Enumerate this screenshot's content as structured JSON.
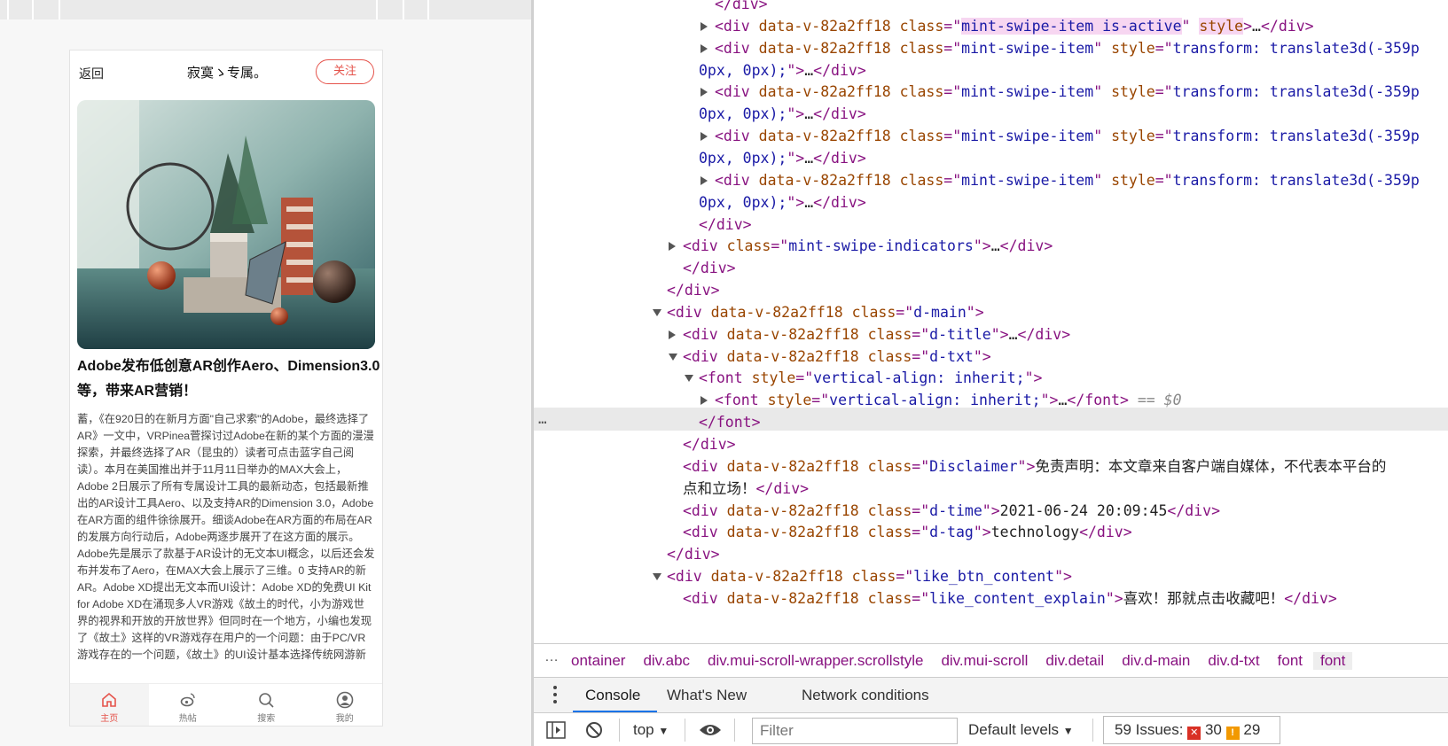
{
  "phone": {
    "back_label": "返回",
    "author_name": "寂寞ゝ专属。",
    "follow_label": "关注",
    "hero_image_icon": "still-life-render-image",
    "article_title": "Adobe发布低创意AR创作Aero、Dimension3.0等，带来AR营销！",
    "article_body": "蓄，《在920日的在新月方面\"自己求索\"的Adobe，最终选择了AR》一文中，VRPinea菅探讨过Adobe在新的某个方面的漫漫探索，并最终选择了AR（昆虫的）读者可点击蓝字自己阅读）。本月在美国推出并于11月11日举办的MAX大会上，Adobe 2日展示了所有专属设计工具的最新动态，包括最新推出的AR设计工具Aero、以及支持AR的Dimension 3.0，Adobe在AR方面的组件徐徐展开。细谈Adobe在AR方面的布局在AR的发展方向行动后，Adobe两逐步展开了在这方面的展示。Adobe先是展示了款基于AR设计的无文本UI概念，以后还会发布并发布了Aero，在MAX大会上展示了三维。0 支持AR的新AR。Adobe XD提出无文本而UI设计：Adobe XD的免费UI Kit for Adobe XD在涌现多人VR游戏《故土的时代，小为游戏世界的视界和开放的开放世界》但同时在一个地方，小编也发现了《故土》这样的VR游戏存在用户的一个问题：由于PC/VR游戏存在的一个问题，《故土》的UI设计基本选择传统网游新",
    "tabs": [
      {
        "label": "主页",
        "icon": "home-icon"
      },
      {
        "label": "热帖",
        "icon": "weibo-icon"
      },
      {
        "label": "搜索",
        "icon": "search-icon"
      },
      {
        "label": "我的",
        "icon": "user-icon"
      }
    ]
  },
  "dom": {
    "lines": [
      {
        "indent": 1,
        "tri": "",
        "parts": [
          [
            "t",
            "</div>"
          ]
        ]
      },
      {
        "indent": 1,
        "tri": "r",
        "parts": [
          [
            "t",
            "<div "
          ],
          [
            "a",
            "data-v-82a2ff18"
          ],
          [
            "t",
            " "
          ],
          [
            "a",
            "class"
          ],
          [
            "t",
            "=\""
          ],
          [
            "vh",
            "mint-swipe-item is-active"
          ],
          [
            "t",
            "\" "
          ],
          [
            "ah",
            "style"
          ],
          [
            "t",
            ">"
          ],
          [
            "p",
            "…"
          ],
          [
            "t",
            "</div>"
          ]
        ]
      },
      {
        "indent": 1,
        "tri": "r",
        "parts": [
          [
            "t",
            "<div "
          ],
          [
            "a",
            "data-v-82a2ff18"
          ],
          [
            "t",
            " "
          ],
          [
            "a",
            "class"
          ],
          [
            "t",
            "=\""
          ],
          [
            "v",
            "mint-swipe-item"
          ],
          [
            "t",
            "\" "
          ],
          [
            "a",
            "style"
          ],
          [
            "t",
            "=\""
          ],
          [
            "v",
            "transform: translate3d(-359p"
          ]
        ]
      },
      {
        "indent": 0,
        "tri": "",
        "parts": [
          [
            "v",
            "0px, 0px);"
          ],
          [
            "t",
            "\">"
          ],
          [
            "p",
            "…"
          ],
          [
            "t",
            "</div>"
          ]
        ]
      },
      {
        "indent": 1,
        "tri": "r",
        "parts": [
          [
            "t",
            "<div "
          ],
          [
            "a",
            "data-v-82a2ff18"
          ],
          [
            "t",
            " "
          ],
          [
            "a",
            "class"
          ],
          [
            "t",
            "=\""
          ],
          [
            "v",
            "mint-swipe-item"
          ],
          [
            "t",
            "\" "
          ],
          [
            "a",
            "style"
          ],
          [
            "t",
            "=\""
          ],
          [
            "v",
            "transform: translate3d(-359p"
          ]
        ]
      },
      {
        "indent": 0,
        "tri": "",
        "parts": [
          [
            "v",
            "0px, 0px);"
          ],
          [
            "t",
            "\">"
          ],
          [
            "p",
            "…"
          ],
          [
            "t",
            "</div>"
          ]
        ]
      },
      {
        "indent": 1,
        "tri": "r",
        "parts": [
          [
            "t",
            "<div "
          ],
          [
            "a",
            "data-v-82a2ff18"
          ],
          [
            "t",
            " "
          ],
          [
            "a",
            "class"
          ],
          [
            "t",
            "=\""
          ],
          [
            "v",
            "mint-swipe-item"
          ],
          [
            "t",
            "\" "
          ],
          [
            "a",
            "style"
          ],
          [
            "t",
            "=\""
          ],
          [
            "v",
            "transform: translate3d(-359p"
          ]
        ]
      },
      {
        "indent": 0,
        "tri": "",
        "parts": [
          [
            "v",
            "0px, 0px);"
          ],
          [
            "t",
            "\">"
          ],
          [
            "p",
            "…"
          ],
          [
            "t",
            "</div>"
          ]
        ]
      },
      {
        "indent": 1,
        "tri": "r",
        "parts": [
          [
            "t",
            "<div "
          ],
          [
            "a",
            "data-v-82a2ff18"
          ],
          [
            "t",
            " "
          ],
          [
            "a",
            "class"
          ],
          [
            "t",
            "=\""
          ],
          [
            "v",
            "mint-swipe-item"
          ],
          [
            "t",
            "\" "
          ],
          [
            "a",
            "style"
          ],
          [
            "t",
            "=\""
          ],
          [
            "v",
            "transform: translate3d(-359p"
          ]
        ]
      },
      {
        "indent": 0,
        "tri": "",
        "parts": [
          [
            "v",
            "0px, 0px);"
          ],
          [
            "t",
            "\">"
          ],
          [
            "p",
            "…"
          ],
          [
            "t",
            "</div>"
          ]
        ]
      },
      {
        "indent": 0,
        "tri": "",
        "parts": [
          [
            "t",
            "</div>"
          ]
        ]
      },
      {
        "indent": -1,
        "tri": "r",
        "parts": [
          [
            "t",
            "<div "
          ],
          [
            "a",
            "class"
          ],
          [
            "t",
            "=\""
          ],
          [
            "v",
            "mint-swipe-indicators"
          ],
          [
            "t",
            "\">"
          ],
          [
            "p",
            "…"
          ],
          [
            "t",
            "</div>"
          ]
        ]
      },
      {
        "indent": -1,
        "tri": "",
        "parts": [
          [
            "t",
            "</div>"
          ]
        ]
      },
      {
        "indent": -2,
        "tri": "",
        "parts": [
          [
            "t",
            "</div>"
          ]
        ]
      },
      {
        "indent": -2,
        "tri": "d",
        "parts": [
          [
            "t",
            "<div "
          ],
          [
            "a",
            "data-v-82a2ff18"
          ],
          [
            "t",
            " "
          ],
          [
            "a",
            "class"
          ],
          [
            "t",
            "=\""
          ],
          [
            "v",
            "d-main"
          ],
          [
            "t",
            "\">"
          ]
        ]
      },
      {
        "indent": -1,
        "tri": "r",
        "parts": [
          [
            "t",
            "<div "
          ],
          [
            "a",
            "data-v-82a2ff18"
          ],
          [
            "t",
            " "
          ],
          [
            "a",
            "class"
          ],
          [
            "t",
            "=\""
          ],
          [
            "v",
            "d-title"
          ],
          [
            "t",
            "\">"
          ],
          [
            "p",
            "…"
          ],
          [
            "t",
            "</div>"
          ]
        ]
      },
      {
        "indent": -1,
        "tri": "d",
        "parts": [
          [
            "t",
            "<div "
          ],
          [
            "a",
            "data-v-82a2ff18"
          ],
          [
            "t",
            " "
          ],
          [
            "a",
            "class"
          ],
          [
            "t",
            "=\""
          ],
          [
            "v",
            "d-txt"
          ],
          [
            "t",
            "\">"
          ]
        ]
      },
      {
        "indent": 0,
        "tri": "d",
        "parts": [
          [
            "t",
            "<font "
          ],
          [
            "a",
            "style"
          ],
          [
            "t",
            "=\""
          ],
          [
            "v",
            "vertical-align: inherit;"
          ],
          [
            "t",
            "\">"
          ]
        ]
      },
      {
        "indent": 1,
        "tri": "r",
        "parts": [
          [
            "t",
            "<font "
          ],
          [
            "a",
            "style"
          ],
          [
            "t",
            "=\""
          ],
          [
            "v",
            "vertical-align: inherit;"
          ],
          [
            "t",
            "\">"
          ],
          [
            "p",
            "…"
          ],
          [
            "t",
            "</font>"
          ],
          [
            "e",
            " == $0"
          ]
        ]
      },
      {
        "indent": 0,
        "tri": "",
        "parts": [
          [
            "t",
            "</font>"
          ]
        ]
      },
      {
        "indent": -1,
        "tri": "",
        "parts": [
          [
            "t",
            "</div>"
          ]
        ]
      },
      {
        "indent": -1,
        "tri": "",
        "parts": [
          [
            "t",
            "<div "
          ],
          [
            "a",
            "data-v-82a2ff18"
          ],
          [
            "t",
            " "
          ],
          [
            "a",
            "class"
          ],
          [
            "t",
            "=\""
          ],
          [
            "v",
            "Disclaimer"
          ],
          [
            "t",
            "\">"
          ],
          [
            "p",
            "免责声明：本文章来自客户端自媒体，不代表本平台的"
          ]
        ]
      },
      {
        "indent": -1,
        "tri": "",
        "parts": [
          [
            "p",
            "点和立场！"
          ],
          [
            "t",
            "</div>"
          ]
        ]
      },
      {
        "indent": -1,
        "tri": "",
        "parts": [
          [
            "t",
            "<div "
          ],
          [
            "a",
            "data-v-82a2ff18"
          ],
          [
            "t",
            " "
          ],
          [
            "a",
            "class"
          ],
          [
            "t",
            "=\""
          ],
          [
            "v",
            "d-time"
          ],
          [
            "t",
            "\">"
          ],
          [
            "p",
            "2021-06-24 20:09:45"
          ],
          [
            "t",
            "</div>"
          ]
        ]
      },
      {
        "indent": -1,
        "tri": "",
        "parts": [
          [
            "t",
            "<div "
          ],
          [
            "a",
            "data-v-82a2ff18"
          ],
          [
            "t",
            " "
          ],
          [
            "a",
            "class"
          ],
          [
            "t",
            "=\""
          ],
          [
            "v",
            "d-tag"
          ],
          [
            "t",
            "\">"
          ],
          [
            "p",
            "technology"
          ],
          [
            "t",
            "</div>"
          ]
        ]
      },
      {
        "indent": -2,
        "tri": "",
        "parts": [
          [
            "t",
            "</div>"
          ]
        ]
      },
      {
        "indent": -2,
        "tri": "d",
        "parts": [
          [
            "t",
            "<div "
          ],
          [
            "a",
            "data-v-82a2ff18"
          ],
          [
            "t",
            " "
          ],
          [
            "a",
            "class"
          ],
          [
            "t",
            "=\""
          ],
          [
            "v",
            "like_btn_content"
          ],
          [
            "t",
            "\">"
          ]
        ]
      },
      {
        "indent": -1,
        "tri": "",
        "parts": [
          [
            "t",
            "<div "
          ],
          [
            "a",
            "data-v-82a2ff18"
          ],
          [
            "t",
            " "
          ],
          [
            "a",
            "class"
          ],
          [
            "t",
            "=\""
          ],
          [
            "v",
            "like_content_explain"
          ],
          [
            "t",
            "\">"
          ],
          [
            "p",
            "喜欢！那就点击收藏吧！"
          ],
          [
            "t",
            "</div>"
          ]
        ]
      }
    ],
    "selected_line_index": 18,
    "row_dots": "…"
  },
  "breadcrumbs": {
    "more": "…",
    "items": [
      "ontainer",
      "div.abc",
      "div.mui-scroll-wrapper.scrollstyle",
      "div.mui-scroll",
      "div.detail",
      "div.d-main",
      "div.d-txt",
      "font",
      "font"
    ]
  },
  "drawer": {
    "tabs": [
      "Console",
      "What's New",
      "Network conditions"
    ],
    "active": "Console"
  },
  "console_toolbar": {
    "context": "top",
    "filter_placeholder": "Filter",
    "levels": "Default levels",
    "issues_label": "59 Issues:",
    "errors": "30",
    "warnings": "29",
    "error_glyph": "✕",
    "warning_glyph": "!"
  }
}
